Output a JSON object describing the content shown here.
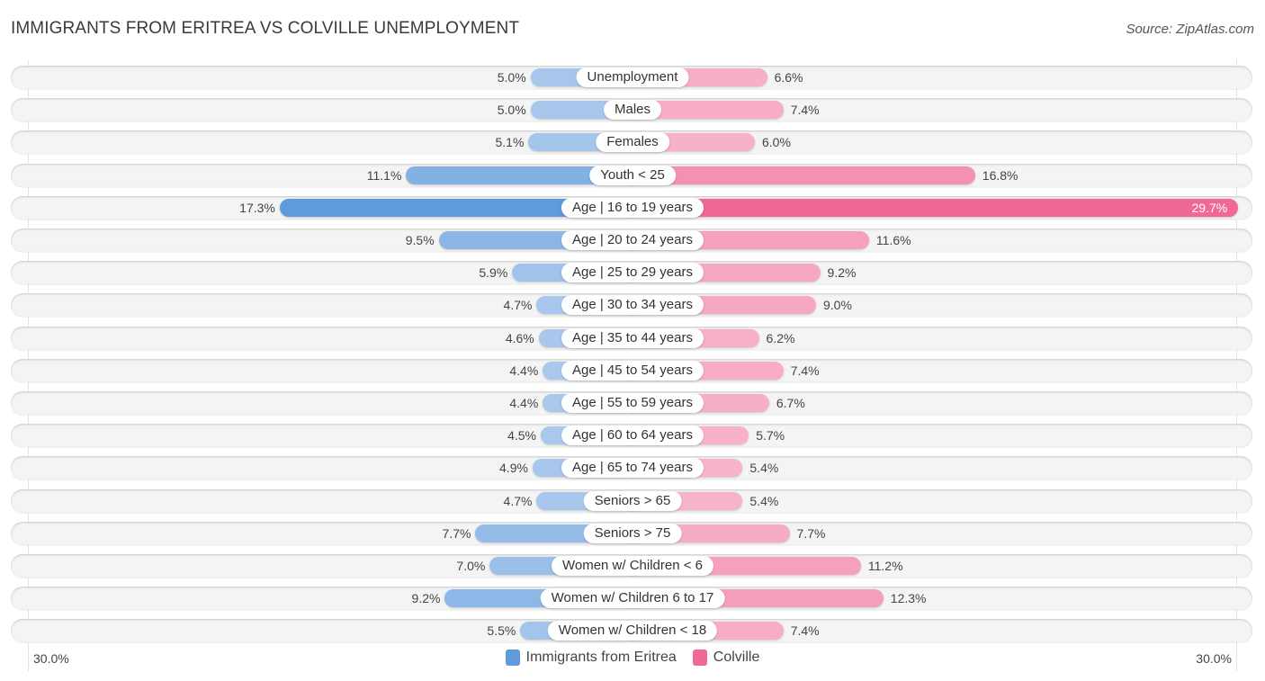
{
  "header": {
    "title": "IMMIGRANTS FROM ERITREA VS COLVILLE UNEMPLOYMENT",
    "source": "Source: ZipAtlas.com"
  },
  "colors": {
    "left_light": "#a9c8ec",
    "left_dark": "#5f9bdc",
    "right_light": "#f7b3c9",
    "right_dark": "#f06895",
    "legend_left": "#5f9bdc",
    "legend_right": "#f06895"
  },
  "chart_data": {
    "type": "bar",
    "orientation": "horizontal-diverging",
    "title": "IMMIGRANTS FROM ERITREA VS COLVILLE UNEMPLOYMENT",
    "xlabel": "",
    "ylabel": "",
    "xlim": [
      0,
      30.0
    ],
    "axis_labels": {
      "left": "30.0%",
      "right": "30.0%"
    },
    "grid": false,
    "legend_position": "bottom-center",
    "categories": [
      "Unemployment",
      "Males",
      "Females",
      "Youth < 25",
      "Age | 16 to 19 years",
      "Age | 20 to 24 years",
      "Age | 25 to 29 years",
      "Age | 30 to 34 years",
      "Age | 35 to 44 years",
      "Age | 45 to 54 years",
      "Age | 55 to 59 years",
      "Age | 60 to 64 years",
      "Age | 65 to 74 years",
      "Seniors > 65",
      "Seniors > 75",
      "Women w/ Children < 6",
      "Women w/ Children 6 to 17",
      "Women w/ Children < 18"
    ],
    "series": [
      {
        "name": "Immigrants from Eritrea",
        "side": "left",
        "values": [
          5.0,
          5.0,
          5.1,
          11.1,
          17.3,
          9.5,
          5.9,
          4.7,
          4.6,
          4.4,
          4.4,
          4.5,
          4.9,
          4.7,
          7.7,
          7.0,
          9.2,
          5.5
        ],
        "labels": [
          "5.0%",
          "5.0%",
          "5.1%",
          "11.1%",
          "17.3%",
          "9.5%",
          "5.9%",
          "4.7%",
          "4.6%",
          "4.4%",
          "4.4%",
          "4.5%",
          "4.9%",
          "4.7%",
          "7.7%",
          "7.0%",
          "9.2%",
          "5.5%"
        ]
      },
      {
        "name": "Colville",
        "side": "right",
        "values": [
          6.6,
          7.4,
          6.0,
          16.8,
          29.7,
          11.6,
          9.2,
          9.0,
          6.2,
          7.4,
          6.7,
          5.7,
          5.4,
          5.4,
          7.7,
          11.2,
          12.3,
          7.4
        ],
        "labels": [
          "6.6%",
          "7.4%",
          "6.0%",
          "16.8%",
          "29.7%",
          "11.6%",
          "9.2%",
          "9.0%",
          "6.2%",
          "7.4%",
          "6.7%",
          "5.7%",
          "5.4%",
          "5.4%",
          "7.7%",
          "11.2%",
          "12.3%",
          "7.4%"
        ]
      }
    ]
  },
  "legend": {
    "items": [
      {
        "label": "Immigrants from Eritrea"
      },
      {
        "label": "Colville"
      }
    ]
  }
}
